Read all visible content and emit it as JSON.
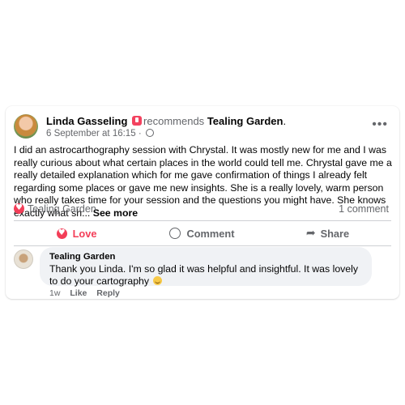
{
  "post": {
    "author": "Linda Gasseling",
    "recommends_text": "recommends",
    "page_name": "Tealing Garden",
    "page_suffix": ".",
    "timestamp": "6 September at 16:15",
    "separator": "·",
    "body": "I did an astrocarthography session with Chrystal. It was mostly new for me and I was really curious about what certain places in the world could tell me. Chrystal gave me a really detailed explanation which for me gave confirmation of things I already felt regarding some places or gave me new insights. She is a really lovely, warm person who really takes time for your session and the questions you might have. She knows exactly what sh...",
    "see_more": "See more",
    "more_label": "•••"
  },
  "stats": {
    "reactor_name": "Tealing Garden",
    "comment_count": "1 comment"
  },
  "actions": {
    "love": "Love",
    "comment": "Comment",
    "share": "Share"
  },
  "comment": {
    "author": "Tealing Garden",
    "text": "Thank you Linda. I'm so glad it was helpful and insightful. It was lovely to do your cartography",
    "age": "1w",
    "like": "Like",
    "reply": "Reply"
  },
  "colors": {
    "love_red": "#f33e58",
    "secondary_text": "#65676b",
    "bubble_bg": "#f0f2f5"
  },
  "icons": {
    "recommend": "recommend-icon",
    "globe": "globe-icon",
    "heart": "heart-icon",
    "comment": "comment-icon",
    "share": "share-arrow-icon",
    "emoji": "smiling-emoji-icon"
  }
}
